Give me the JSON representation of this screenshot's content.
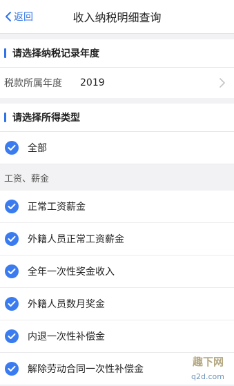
{
  "nav": {
    "back_label": "返回",
    "title": "收入纳税明细查询"
  },
  "year_section": {
    "title": "请选择纳税记录年度",
    "row_label": "税款所属年度",
    "row_value": "2019"
  },
  "type_section": {
    "title": "请选择所得类型"
  },
  "all_option": {
    "label": "全部",
    "checked": true
  },
  "group": {
    "label": "工资、薪金"
  },
  "options": [
    {
      "label": "正常工资薪金",
      "checked": true
    },
    {
      "label": "外籍人员正常工资薪金",
      "checked": true
    },
    {
      "label": "全年一次性奖金收入",
      "checked": true
    },
    {
      "label": "外籍人员数月奖金",
      "checked": true
    },
    {
      "label": "内退一次性补偿金",
      "checked": true
    },
    {
      "label": "解除劳动合同一次性补偿金",
      "checked": true
    }
  ],
  "watermark": {
    "text1": "趣下网",
    "text2": "q2d.com"
  },
  "colors": {
    "accent": "#2f73e8",
    "check": "#3a7cf0"
  }
}
